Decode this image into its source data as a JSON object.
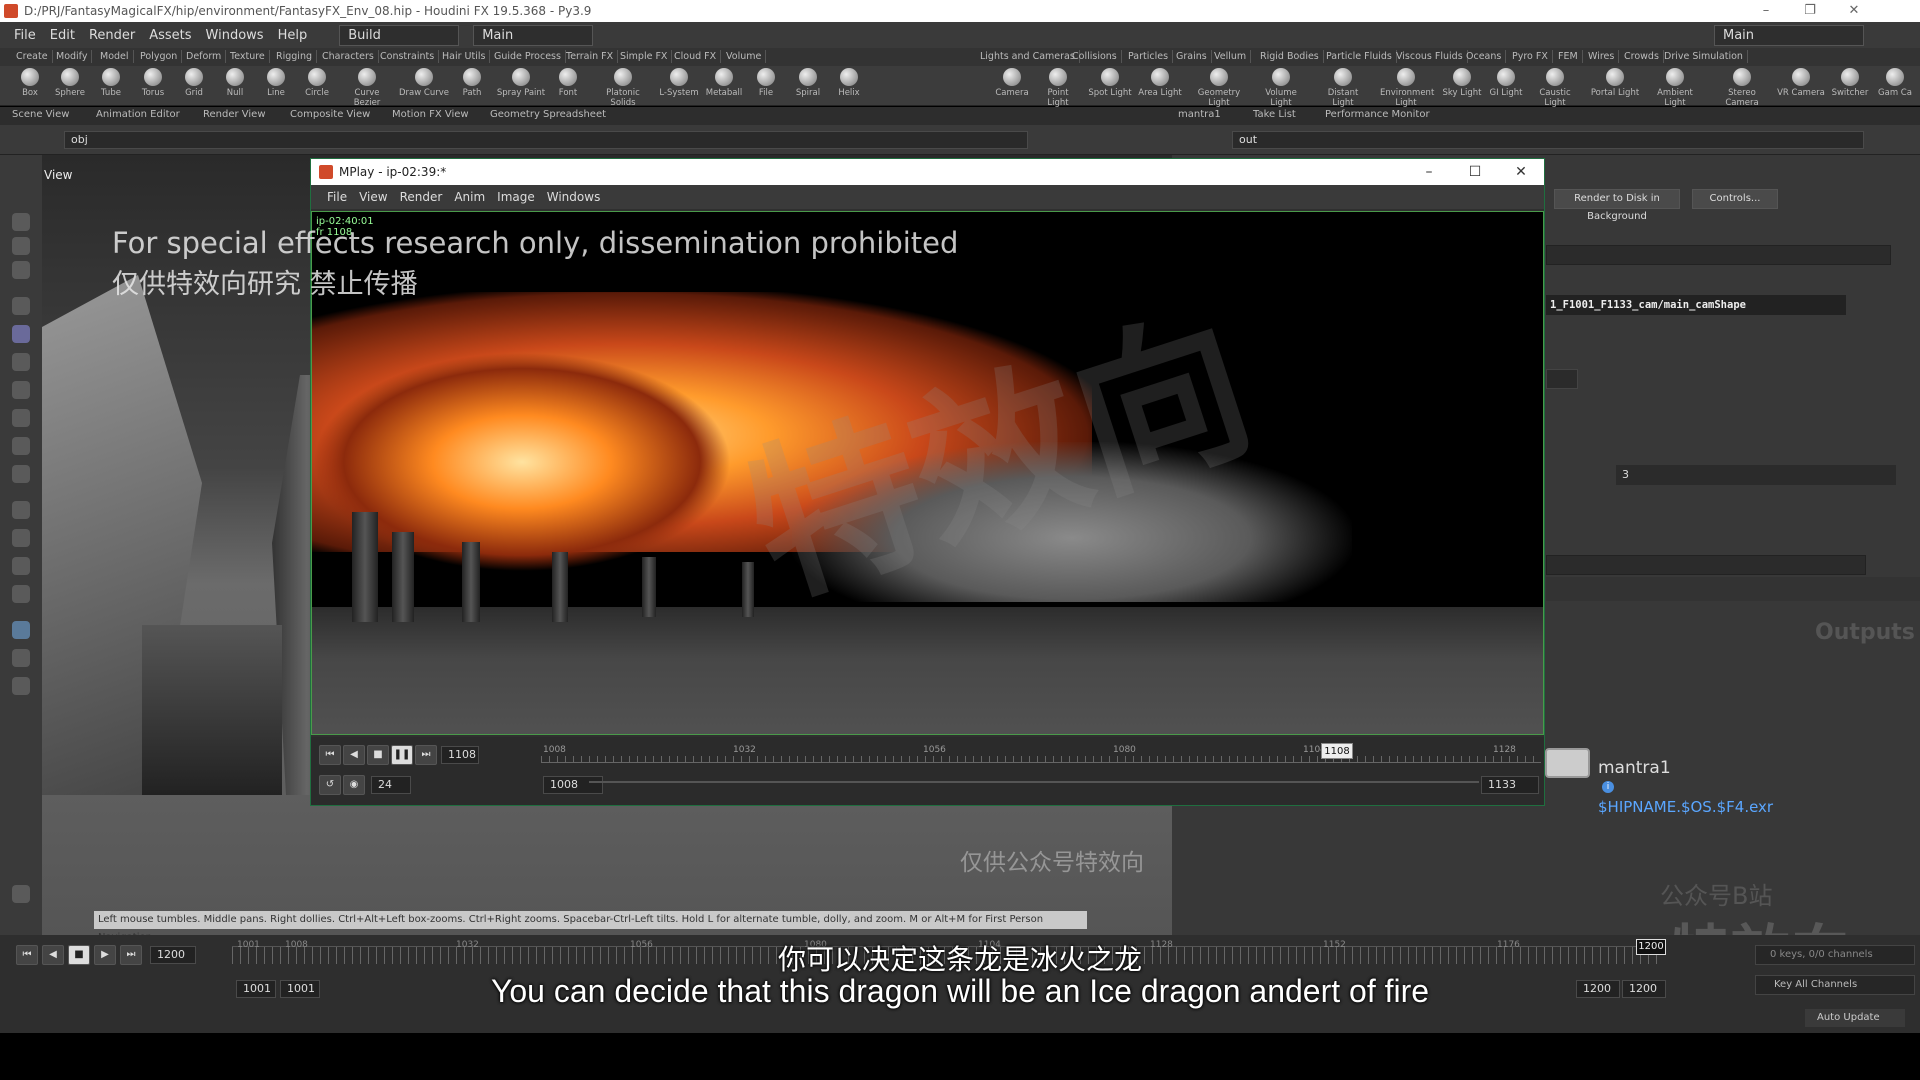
{
  "window": {
    "title": "D:/PRJ/FantasyMagicalFX/hip/environment/FantasyFX_Env_08.hip - Houdini FX 19.5.368 - Py3.9"
  },
  "menu": {
    "items": [
      "File",
      "Edit",
      "Render",
      "Assets",
      "Windows",
      "Help"
    ],
    "desktop": "Build",
    "shelf_set": "Main",
    "right_desktop": "Main"
  },
  "shelf_tabs_left": [
    "Create",
    "Modify",
    "Model",
    "Polygon",
    "Deform",
    "Texture",
    "Rigging",
    "Characters",
    "Constraints",
    "Hair Utils",
    "Guide Process",
    "Terrain FX",
    "Simple FX",
    "Cloud FX",
    "Volume"
  ],
  "shelf_tabs_right": [
    "Lights and Cameras",
    "Collisions",
    "Particles",
    "Grains",
    "Vellum",
    "Rigid Bodies",
    "Particle Fluids",
    "Viscous Fluids",
    "Oceans",
    "Pyro FX",
    "FEM",
    "Wires",
    "Crowds",
    "Drive Simulation"
  ],
  "tools_left": [
    "Box",
    "Sphere",
    "Tube",
    "Torus",
    "Grid",
    "Null",
    "Line",
    "Circle",
    "Curve Bezier",
    "Draw Curve",
    "Path",
    "Spray Paint",
    "Font",
    "Platonic Solids",
    "L-System",
    "Metaball",
    "File",
    "Spiral",
    "Helix"
  ],
  "tools_right": [
    "Camera",
    "Point Light",
    "Spot Light",
    "Area Light",
    "Geometry Light",
    "Volume Light",
    "Distant Light",
    "Environment Light",
    "Sky Light",
    "GI Light",
    "Caustic Light",
    "Portal Light",
    "Ambient Light",
    "Stereo Camera",
    "VR Camera",
    "Switcher",
    "Gam Ca"
  ],
  "pane_tabs_left": [
    "Scene View",
    "Animation Editor",
    "Render View",
    "Composite View",
    "Motion FX View",
    "Geometry Spreadsheet"
  ],
  "pane_tabs_right": [
    "mantra1",
    "Take List",
    "Performance Monitor"
  ],
  "path_left": "obj",
  "path_right": "out",
  "viewport": {
    "label": "View",
    "hint": "Left mouse tumbles. Middle pans. Right dollies. Ctrl+Alt+Left box-zooms. Ctrl+Right zooms. Spacebar-Ctrl-Left tilts. Hold L for alternate tumble, dolly, and zoom.    M or Alt+M for First Person Navigation."
  },
  "params": {
    "render_bg_button": "Render to Disk in Background",
    "controls_button": "Controls...",
    "camera_path": "1_F1001_F1133_cam/main_camShape",
    "field_value": "3"
  },
  "network": {
    "outputs_label": "Outputs",
    "node_name": "mantra1",
    "node_path": "$HIPNAME.$OS.$F4.exr"
  },
  "mplay": {
    "title": "MPlay - ip-02:39:*",
    "menu": [
      "File",
      "View",
      "Render",
      "Anim",
      "Image",
      "Windows"
    ],
    "overlay_info": [
      "ip-02:40:01",
      "fr 1108"
    ],
    "frame": "1108",
    "fps": "24",
    "range_start": "1008",
    "range_end": "1133",
    "ruler_ticks": [
      "1008",
      "1032",
      "1056",
      "1080",
      "1104",
      "1128"
    ],
    "cursor_frame": "1108"
  },
  "watermark": {
    "line1": "For special effects research only, dissemination prohibited",
    "line2": "仅供特效向研究 禁止传播",
    "big": "特效向",
    "bottom": "仅供公众号特效向",
    "corner1": "公众号B站",
    "corner2": "特效向"
  },
  "timeline": {
    "current_frame": "1200",
    "start": "1001",
    "start2": "1001",
    "end": "1200",
    "end2": "1200",
    "ticks": [
      "1001",
      "1008",
      "1032",
      "1056",
      "1080",
      "1104",
      "1128",
      "1152",
      "1176"
    ],
    "cursor": "1200",
    "keys_info": "0 keys, 0/0 channels",
    "key_all": "Key All Channels"
  },
  "status": {
    "auto_update": "Auto Update"
  },
  "subtitles": {
    "cn": "你可以决定这条龙是冰火之龙",
    "en": "You can decide that this dragon will be an Ice dragon andert of fire"
  },
  "colors": {
    "accent_green": "#1f6f3f",
    "link_blue": "#5aa6ff",
    "fire": "#ff9b2c"
  }
}
